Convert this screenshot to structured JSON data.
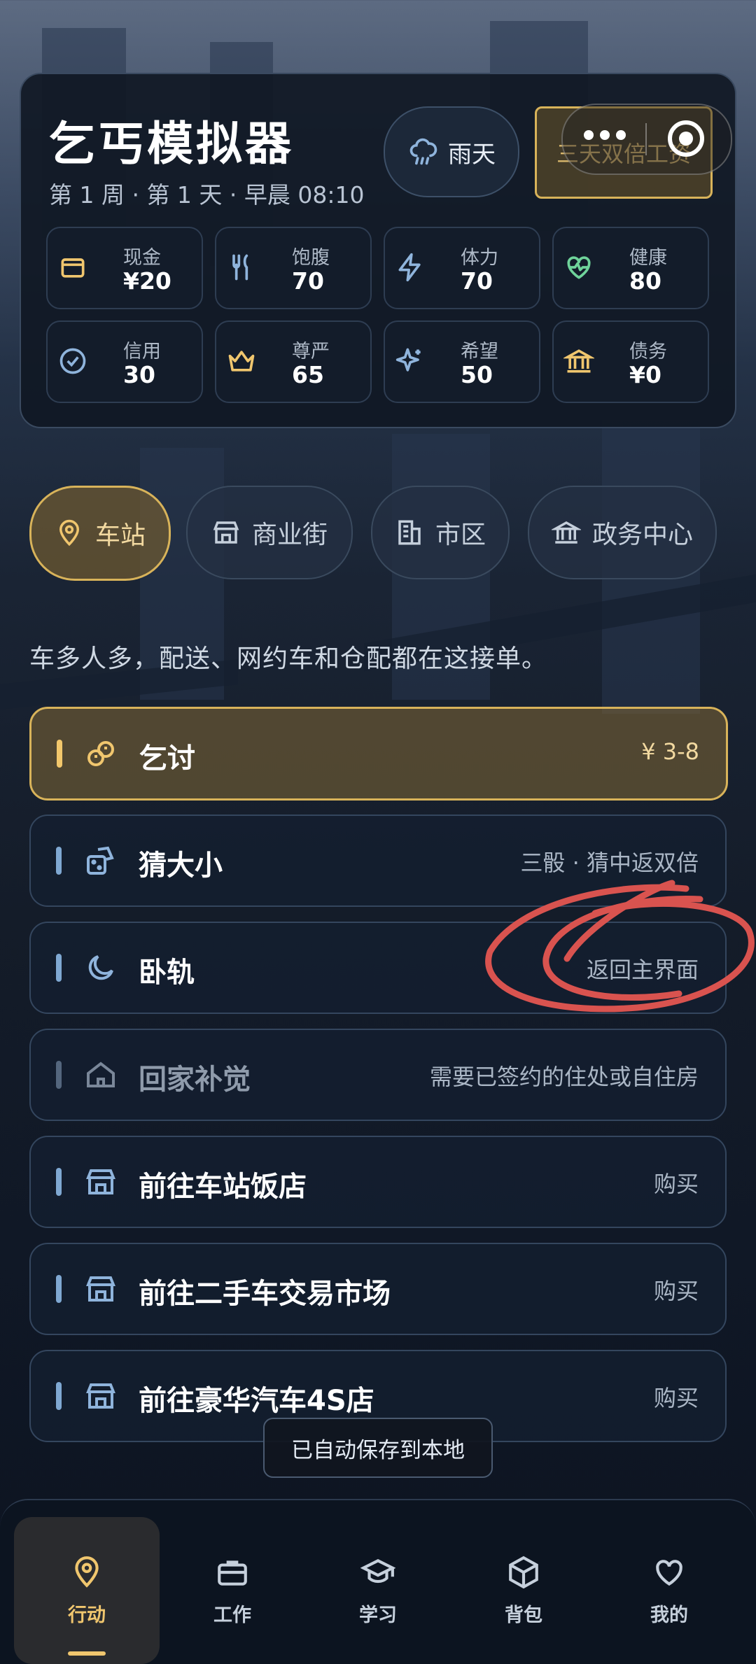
{
  "header": {
    "title": "乞丐模拟器",
    "subtitle": "第 1 周 · 第 1 天 · 早晨 08:10",
    "weather_label": "雨天",
    "bonus_label": "三天双倍工资"
  },
  "stats": [
    {
      "label": "现金",
      "value": "¥20",
      "icon": "wallet-icon"
    },
    {
      "label": "饱腹",
      "value": "70",
      "icon": "utensils-icon"
    },
    {
      "label": "体力",
      "value": "70",
      "icon": "lightning-icon"
    },
    {
      "label": "健康",
      "value": "80",
      "icon": "heart-pulse-icon"
    },
    {
      "label": "信用",
      "value": "30",
      "icon": "badge-check-icon"
    },
    {
      "label": "尊严",
      "value": "65",
      "icon": "crown-icon"
    },
    {
      "label": "希望",
      "value": "50",
      "icon": "sparkle-icon"
    },
    {
      "label": "债务",
      "value": "¥0",
      "icon": "bank-icon"
    }
  ],
  "location_tabs": [
    {
      "label": "车站",
      "icon": "map-pin-icon",
      "active": true
    },
    {
      "label": "商业街",
      "icon": "store-icon",
      "active": false
    },
    {
      "label": "市区",
      "icon": "building-icon",
      "active": false
    },
    {
      "label": "政务中心",
      "icon": "government-icon",
      "active": false
    }
  ],
  "location_description": "车多人多，配送、网约车和仓配都在这接单。",
  "actions": [
    {
      "name": "乞讨",
      "note": "¥ 3-8",
      "icon": "coins-icon"
    },
    {
      "name": "猜大小",
      "note": "三骰 · 猜中返双倍",
      "icon": "dice-icon"
    },
    {
      "name": "卧轨",
      "note": "返回主界面",
      "icon": "moon-icon"
    },
    {
      "name": "回家补觉",
      "note": "需要已签约的住处或自住房",
      "icon": "home-icon"
    },
    {
      "name": "前往车站饭店",
      "note": "购买",
      "icon": "store-icon"
    },
    {
      "name": "前往二手车交易市场",
      "note": "购买",
      "icon": "store-icon"
    },
    {
      "name": "前往豪华汽车4S店",
      "note": "购买",
      "icon": "store-icon"
    }
  ],
  "toast": "已自动保存到本地",
  "bottom_nav": [
    {
      "label": "行动",
      "icon": "map-pin-icon",
      "active": true
    },
    {
      "label": "工作",
      "icon": "briefcase-icon",
      "active": false
    },
    {
      "label": "学习",
      "icon": "graduation-cap-icon",
      "active": false
    },
    {
      "label": "背包",
      "icon": "package-icon",
      "active": false
    },
    {
      "label": "我的",
      "icon": "heart-icon",
      "active": false
    }
  ],
  "colors": {
    "accent_gold": "#d8b35a",
    "icon_blue": "#8fb4dc",
    "icon_gold": "#f0c66e"
  }
}
